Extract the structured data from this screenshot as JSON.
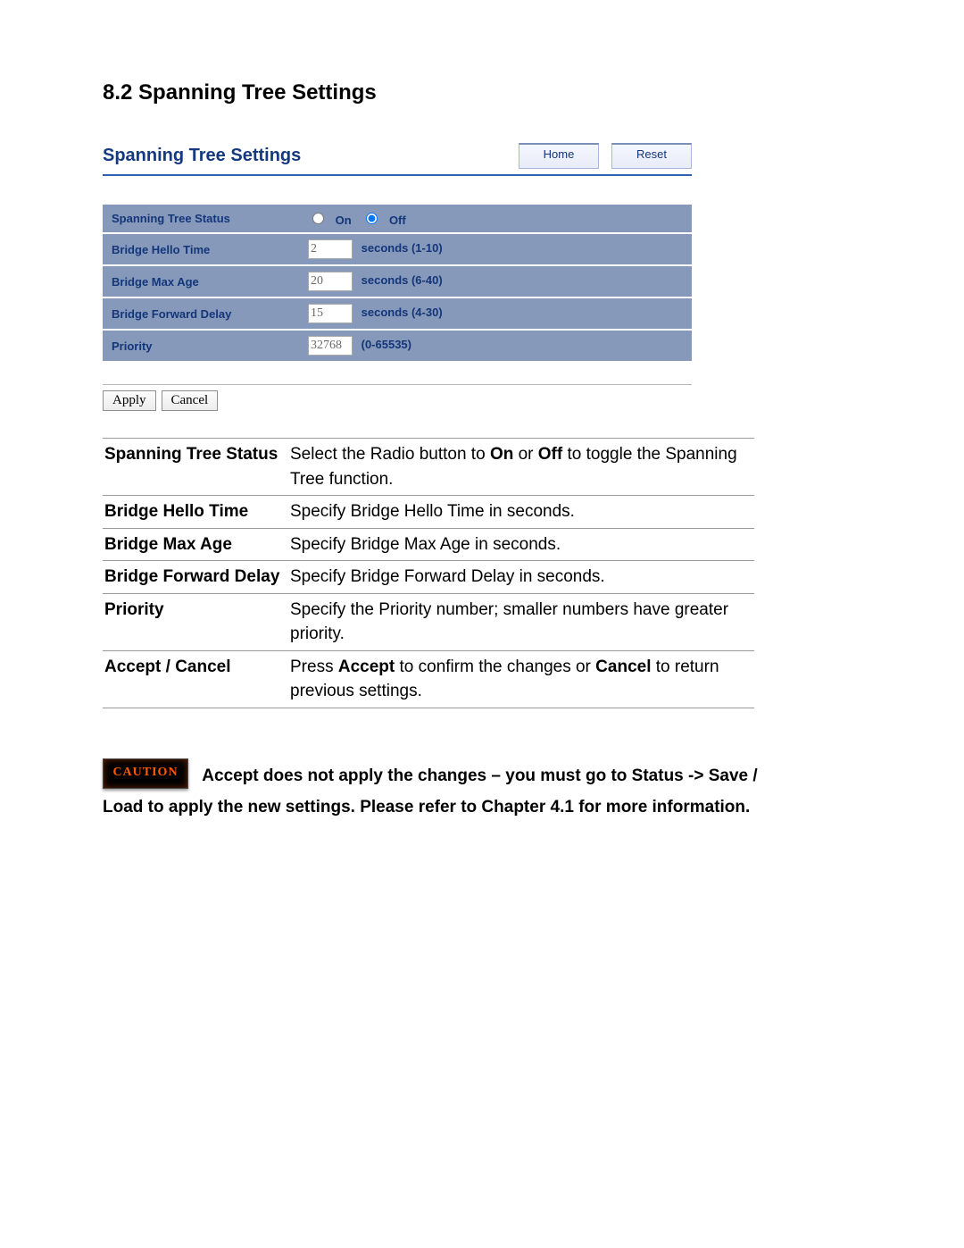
{
  "section_number": "8.2",
  "section_title": "Spanning Tree Settings",
  "panel": {
    "title": "Spanning Tree Settings",
    "home_btn": "Home",
    "reset_btn": "Reset",
    "rows": {
      "status": {
        "label": "Spanning Tree Status",
        "on": "On",
        "off": "Off",
        "selected": "Off"
      },
      "hello": {
        "label": "Bridge Hello Time",
        "value": "2",
        "suffix": "seconds (1-10)"
      },
      "maxage": {
        "label": "Bridge Max Age",
        "value": "20",
        "suffix": "seconds (6-40)"
      },
      "fwd": {
        "label": "Bridge Forward Delay",
        "value": "15",
        "suffix": "seconds (4-30)"
      },
      "prio": {
        "label": "Priority",
        "value": "32768",
        "suffix": "(0-65535)"
      }
    },
    "apply_btn": "Apply",
    "cancel_btn": "Cancel"
  },
  "desc": [
    {
      "term": "Spanning Tree Status",
      "text_pre": "Select the Radio button to ",
      "b1": "On",
      "mid": " or ",
      "b2": "Off",
      "text_post": " to toggle the Spanning Tree function."
    },
    {
      "term": "Bridge Hello Time",
      "text": "Specify Bridge Hello Time in seconds."
    },
    {
      "term": "Bridge Max Age",
      "text": "Specify Bridge Max Age in seconds."
    },
    {
      "term": "Bridge Forward Delay",
      "text": "Specify Bridge Forward Delay in seconds."
    },
    {
      "term": "Priority",
      "text": "Specify the Priority number; smaller numbers have greater priority."
    },
    {
      "term": "Accept / Cancel",
      "text_pre": "Press ",
      "b1": "Accept",
      "mid": " to confirm the changes or ",
      "b2": "Cancel",
      "text_post": " to return previous settings."
    }
  ],
  "caution": {
    "badge": "CAUTION",
    "text": "Accept does not apply the changes – you must go to Status -> Save / Load to apply the new settings. Please refer to Chapter 4.1 for more information."
  }
}
